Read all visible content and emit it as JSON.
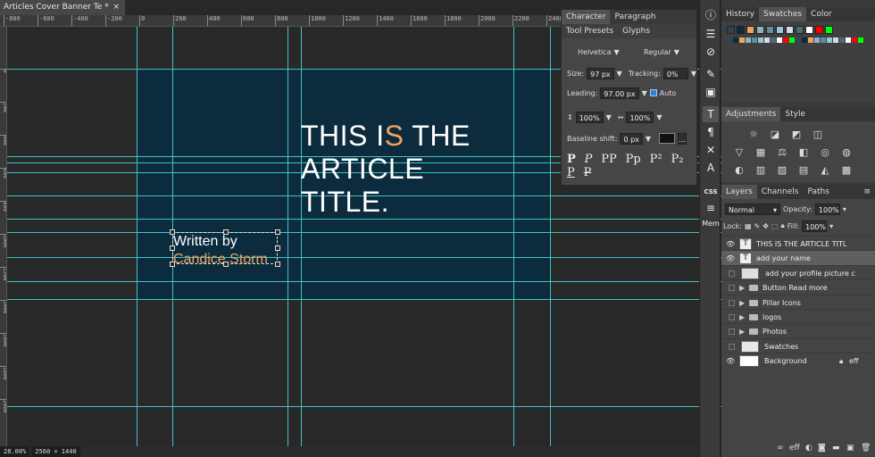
{
  "document": {
    "tab_title": "Articles Cover Banner Te",
    "tab_suffix": "*",
    "close": "×",
    "zoom": "28.00%",
    "dimensions": "2560 × 1440"
  },
  "ruler": {
    "top_labels": [
      "-800",
      "-600",
      "-400",
      "-200",
      "0",
      "200",
      "400",
      "600",
      "800",
      "1000",
      "1200",
      "1400",
      "1600",
      "1800",
      "2000",
      "2200",
      "2400"
    ],
    "left_labels": [
      "0",
      "200",
      "400",
      "600",
      "800",
      "1000",
      "1200",
      "1400",
      "1600",
      "1800",
      "2000"
    ]
  },
  "canvas": {
    "title_pre": "THIS I",
    "title_accent": "S",
    "title_post": " THE",
    "title_line2": "ARTICLE",
    "title_line3": "TITLE.",
    "byline_line1": "Written by",
    "byline_line2": "Candice Storm",
    "artboard_color": "#0c2b3d",
    "accent_color": "#f0a35e",
    "guide_color": "#3fc3c8"
  },
  "character_panel": {
    "tabs": [
      "Character",
      "Paragraph"
    ],
    "tabs2": [
      "Tool Presets",
      "Glyphs"
    ],
    "font_family": "Helvetica",
    "font_style": "Regular",
    "size_label": "Size:",
    "size_value": "97 px",
    "tracking_label": "Tracking:",
    "tracking_value": "0%",
    "leading_label": "Leading:",
    "leading_value": "97.00 px",
    "auto_label": "Auto",
    "vscale_value": "100%",
    "hscale_value": "100%",
    "baseline_label": "Baseline shift:",
    "baseline_value": "0 px",
    "type_styles": [
      "P",
      "P",
      "PP",
      "Pp",
      "P²",
      "P₂",
      "P",
      "P"
    ]
  },
  "tools": {
    "icons": [
      "info-icon",
      "paragraph-lines-icon",
      "circle-slash-icon",
      "brush-icon",
      "square-icon",
      "type-icon",
      "pilcrow-icon",
      "wrench-icon",
      "glyph-a-icon",
      "css-icon",
      "menu-icon"
    ],
    "css_label": "CSS",
    "mem_label": "Mem"
  },
  "history_panel": {
    "tabs": [
      "History",
      "Swatches",
      "Color"
    ],
    "active_tab": "Swatches",
    "swatches": [
      "#2f4454",
      "#0c2b3d",
      "#f0a35e",
      "#8fb2c2",
      "#5f8ea0",
      "#9ec3d0",
      "#cfdde3",
      "#4a6b7d",
      "#ffffff",
      "#ff0000",
      "#00ff00"
    ]
  },
  "adjustments_panel": {
    "tabs": [
      "Adjustments",
      "Style"
    ]
  },
  "layers_panel": {
    "tabs": [
      "Layers",
      "Channels",
      "Paths"
    ],
    "blend_mode": "Normal",
    "opacity_label": "Opacity:",
    "opacity_value": "100%",
    "lock_label": "Lock:",
    "fill_label": "Fill:",
    "fill_value": "100%",
    "layers": [
      {
        "name": "THIS IS THE ARTICLE TITL",
        "kind": "text",
        "visible": true,
        "selected": false
      },
      {
        "name": "add your name",
        "kind": "text",
        "visible": true,
        "selected": true
      },
      {
        "name": "add your profile picture c",
        "kind": "smart",
        "visible": false,
        "selected": false
      },
      {
        "name": "Button Read more",
        "kind": "folder",
        "visible": false,
        "selected": false
      },
      {
        "name": "Pillar Icons",
        "kind": "folder",
        "visible": false,
        "selected": false
      },
      {
        "name": "logos",
        "kind": "folder",
        "visible": false,
        "selected": false
      },
      {
        "name": "Photos",
        "kind": "folder",
        "visible": false,
        "selected": false
      },
      {
        "name": "Swatches",
        "kind": "image",
        "visible": false,
        "selected": false
      },
      {
        "name": "Background",
        "kind": "fill",
        "visible": true,
        "selected": false
      }
    ],
    "eff_label": "eff"
  }
}
